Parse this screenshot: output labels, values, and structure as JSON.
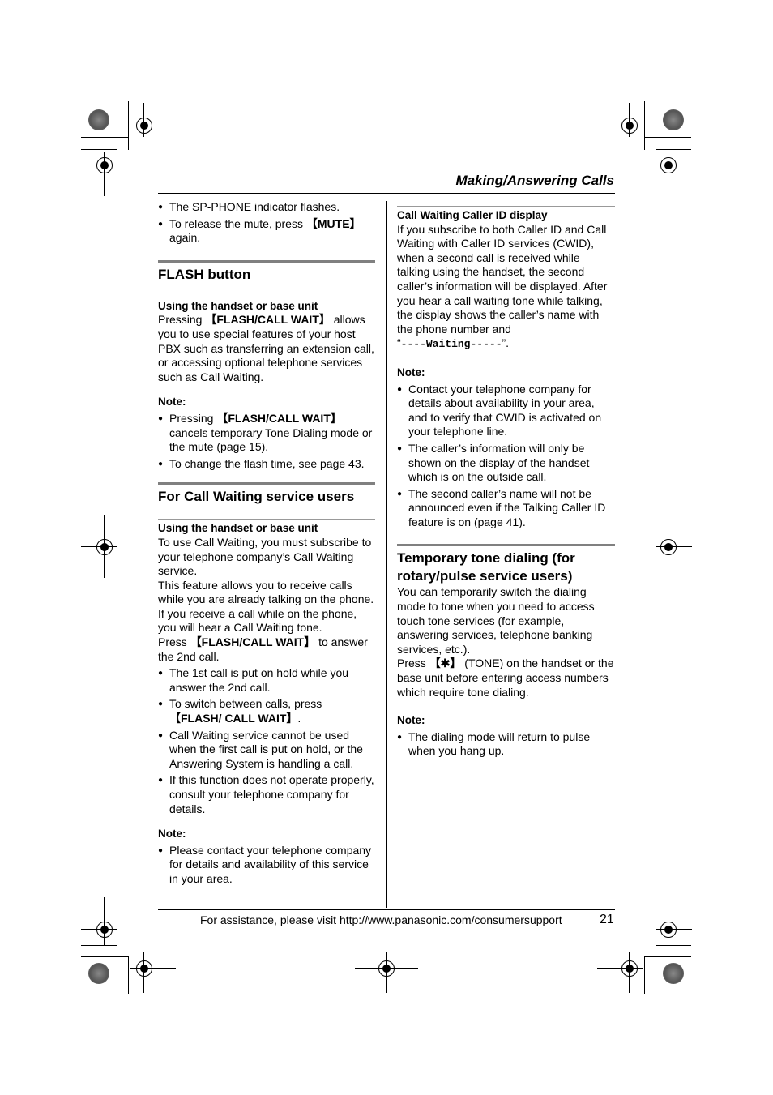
{
  "header": {
    "title": "Making/Answering Calls"
  },
  "left": {
    "intro_bullets": [
      "The SP-PHONE indicator flashes.",
      "To release the mute, press"
    ],
    "mute_key": "【MUTE】",
    "again": "again.",
    "flash": {
      "title": "FLASH button",
      "subtitle": "Using the handset or base unit",
      "p1_a": "Pressing ",
      "p1_key": "【FLASH/CALL WAIT】",
      "p1_b": " allows you to use special features of your host PBX such as transferring an extension call, or accessing optional telephone services such as Call Waiting.",
      "note_label": "Note:",
      "note1_a": "Pressing ",
      "note1_key": "【FLASH/CALL WAIT】",
      "note1_b": " cancels temporary Tone Dialing mode or the mute (page 15).",
      "note2": "To change the flash time, see page 43."
    },
    "cw": {
      "title": "For Call Waiting service users",
      "subtitle": "Using the handset or base unit",
      "p1": "To use Call Waiting, you must subscribe to your telephone company’s Call Waiting service.",
      "p2": "This feature allows you to receive calls while you are already talking on the phone. If you receive a call while on the phone, you will hear a Call Waiting tone.",
      "p3_a": "Press ",
      "p3_key": "【FLASH/CALL WAIT】",
      "p3_b": " to answer the 2nd call.",
      "b1": "The 1st call is put on hold while you answer the 2nd call.",
      "b2_a": "To switch between calls, press ",
      "b2_key": "【FLASH/ CALL WAIT】",
      "b2_b": ".",
      "b3": "Call Waiting service cannot be used when the first call is put on hold, or the Answering System is handling a call.",
      "b4": "If this function does not operate properly, consult your telephone company for details.",
      "note_label": "Note:",
      "note1": "Please contact your telephone company for details and availability of this service in your area."
    }
  },
  "right": {
    "cwid": {
      "subtitle": "Call Waiting Caller ID display",
      "p1": "If you subscribe to both Caller ID and Call Waiting with Caller ID services (CWID), when a second call is received while talking using the handset, the second caller’s information will be displayed. After you hear a call waiting tone while talking, the display shows the caller’s name with the phone number and",
      "display_text": "----Waiting-----",
      "note_label": "Note:",
      "notes": [
        "Contact your telephone company for details about availability in your area, and to verify that CWID is activated on your telephone line.",
        "The caller’s information will only be shown on the display of the handset which is on the outside call.",
        "The second caller’s name will not be announced even if the Talking Caller ID feature is on (page 41)."
      ]
    },
    "tone": {
      "title": "Temporary tone dialing (for rotary/pulse service users)",
      "p1": "You can temporarily switch the dialing mode to tone when you need to access touch tone services (for example, answering services, telephone banking services, etc.).",
      "p2_a": "Press ",
      "p2_key": "【✱】",
      "p2_b": " (TONE) on the handset or the base unit before entering access numbers which require tone dialing.",
      "note_label": "Note:",
      "note1": "The dialing mode will return to pulse when you hang up."
    }
  },
  "footer": {
    "text": "For assistance, please visit http://www.panasonic.com/consumersupport",
    "page_number": "21"
  }
}
